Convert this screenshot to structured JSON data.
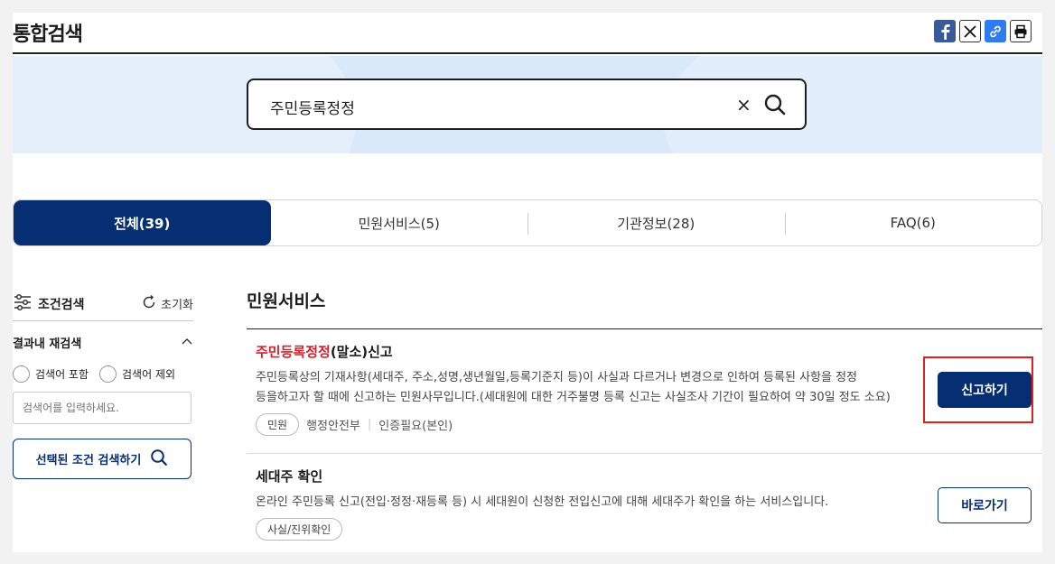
{
  "header": {
    "title": "통합검색",
    "share_icons": [
      "facebook-icon",
      "x-icon",
      "link-icon",
      "print-icon"
    ]
  },
  "search": {
    "value": "주민등록정정"
  },
  "tabs": [
    {
      "label": "전체(39)",
      "active": true
    },
    {
      "label": "민원서비스(5)",
      "active": false
    },
    {
      "label": "기관정보(28)",
      "active": false
    },
    {
      "label": "FAQ(6)",
      "active": false
    }
  ],
  "sidebar": {
    "title": "조건검색",
    "reset_label": "초기화",
    "research_title": "결과내 재검색",
    "include_label": "검색어 포함",
    "exclude_label": "검색어 제외",
    "input_placeholder": "검색어를 입력하세요.",
    "search_button_label": "선택된 조건 검색하기"
  },
  "main": {
    "section_title": "민원서비스",
    "results": [
      {
        "title_highlight": "주민등록정정",
        "title_rest": "(말소)신고",
        "desc_line1": "주민등록상의 기재사항(세대주, 주소,성명,생년월일,등록기준지 등)이 사실과 다르거나 변경으로 인하여 등록된 사항을 정정",
        "desc_line2": "등을하고자 할 때에 신고하는 민원사무입니다.(세대원에 대한 거주불명 등록 신고는 사실조사 기간이 필요하여 약 30일 정도 소요)",
        "tag": "민원",
        "agency": "행정안전부",
        "auth": "인증필요(본인)",
        "button": "신고하기"
      },
      {
        "title": "세대주 확인",
        "desc": "온라인 주민등록 신고(전입·정정·재등록 등) 시 세대원이 신청한 전입신고에 대해 세대주가 확인을 하는 서비스입니다.",
        "tag": "사실/진위확인",
        "button": "바로가기"
      }
    ]
  },
  "colors": {
    "primary": "#052f72",
    "highlight": "#d51f2a",
    "band": "#d9e9fa",
    "focus_box": "#e02020"
  }
}
